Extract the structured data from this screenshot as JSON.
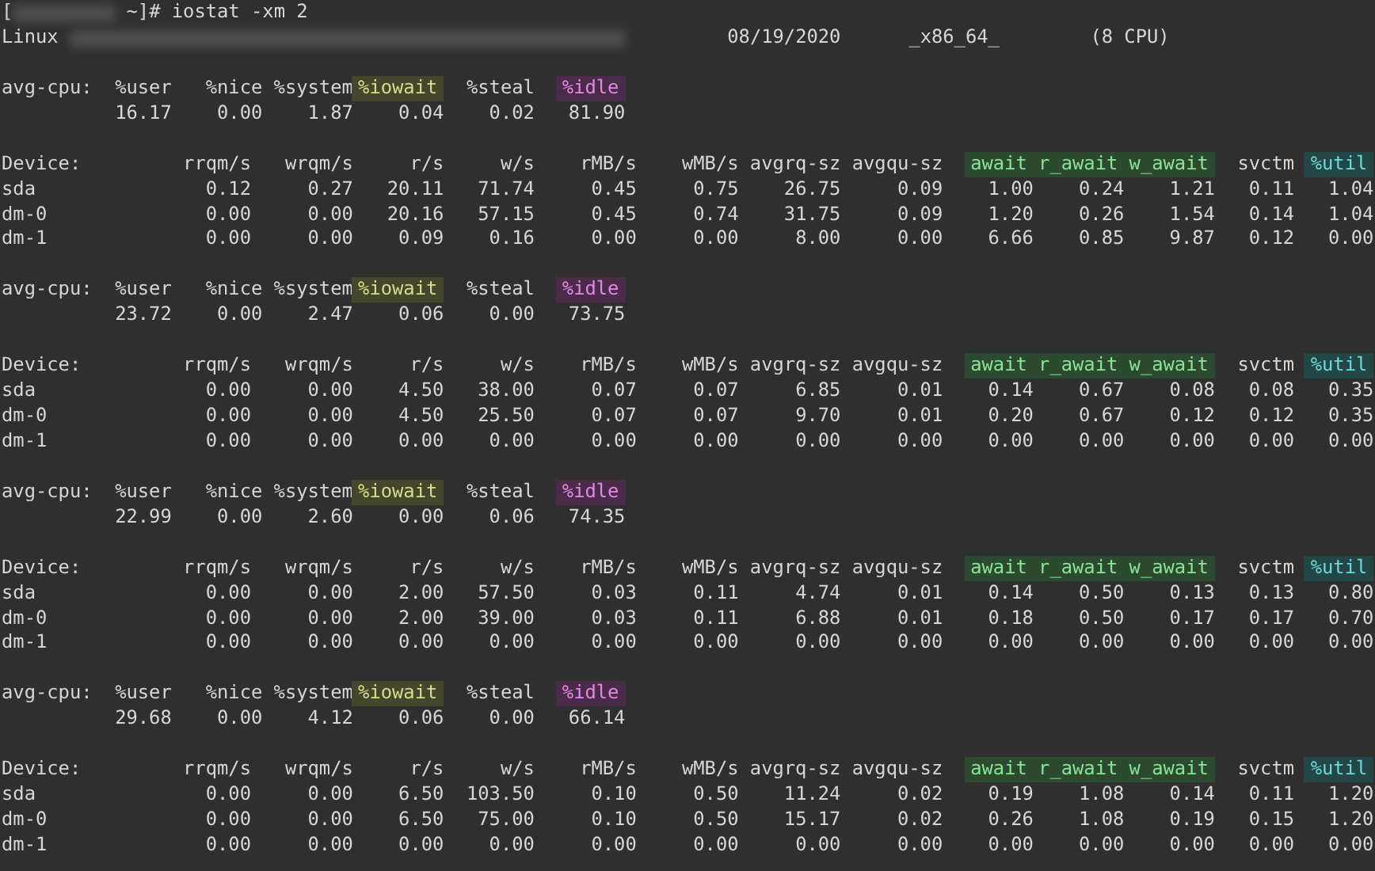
{
  "prompt": {
    "open": "[",
    "command": "~]# iostat -xm 2"
  },
  "system": {
    "os": "Linux",
    "date": "08/19/2020",
    "arch": "_x86_64_",
    "cpus": "(8 CPU)"
  },
  "blocks": [
    {
      "cpu_label": "avg-cpu:",
      "cpu_columns": [
        {
          "label": "%user"
        },
        {
          "label": "%nice"
        },
        {
          "label": "%system"
        },
        {
          "label": "%iowait",
          "color": "#45472d"
        },
        {
          "label": "%steal"
        },
        {
          "label": "%idle",
          "color": "#4a2c4a"
        }
      ],
      "cpu_values": [
        "16.17",
        "0.00",
        "1.87",
        "0.04",
        "0.02",
        "81.90"
      ],
      "device_label": "Device:",
      "device_columns": [
        {
          "label": "rrqm/s"
        },
        {
          "label": "wrqm/s"
        },
        {
          "label": "r/s"
        },
        {
          "label": "w/s"
        },
        {
          "label": "rMB/s"
        },
        {
          "label": "wMB/s"
        },
        {
          "label": "avgrq-sz"
        },
        {
          "label": "avgqu-sz"
        },
        {
          "label": "await",
          "color": "#2c4a30"
        },
        {
          "label": "r_await",
          "color": "#2c4a30"
        },
        {
          "label": "w_await",
          "color": "#2c4a30"
        },
        {
          "label": "svctm"
        },
        {
          "label": "%util",
          "color": "#234646"
        }
      ],
      "rows": [
        {
          "device": "sda",
          "values": [
            "0.12",
            "0.27",
            "20.11",
            "71.74",
            "0.45",
            "0.75",
            "26.75",
            "0.09",
            "1.00",
            "0.24",
            "1.21",
            "0.11",
            "1.04"
          ]
        },
        {
          "device": "dm-0",
          "values": [
            "0.00",
            "0.00",
            "20.16",
            "57.15",
            "0.45",
            "0.74",
            "31.75",
            "0.09",
            "1.20",
            "0.26",
            "1.54",
            "0.14",
            "1.04"
          ]
        },
        {
          "device": "dm-1",
          "values": [
            "0.00",
            "0.00",
            "0.09",
            "0.16",
            "0.00",
            "0.00",
            "8.00",
            "0.00",
            "6.66",
            "0.85",
            "9.87",
            "0.12",
            "0.00"
          ]
        }
      ]
    },
    {
      "cpu_label": "avg-cpu:",
      "cpu_columns": [
        {
          "label": "%user"
        },
        {
          "label": "%nice"
        },
        {
          "label": "%system"
        },
        {
          "label": "%iowait",
          "color": "#45472d"
        },
        {
          "label": "%steal"
        },
        {
          "label": "%idle",
          "color": "#4a2c4a"
        }
      ],
      "cpu_values": [
        "23.72",
        "0.00",
        "2.47",
        "0.06",
        "0.00",
        "73.75"
      ],
      "device_label": "Device:",
      "device_columns": [
        {
          "label": "rrqm/s"
        },
        {
          "label": "wrqm/s"
        },
        {
          "label": "r/s"
        },
        {
          "label": "w/s"
        },
        {
          "label": "rMB/s"
        },
        {
          "label": "wMB/s"
        },
        {
          "label": "avgrq-sz"
        },
        {
          "label": "avgqu-sz"
        },
        {
          "label": "await",
          "color": "#2c4a30"
        },
        {
          "label": "r_await",
          "color": "#2c4a30"
        },
        {
          "label": "w_await",
          "color": "#2c4a30"
        },
        {
          "label": "svctm"
        },
        {
          "label": "%util",
          "color": "#234646"
        }
      ],
      "rows": [
        {
          "device": "sda",
          "values": [
            "0.00",
            "0.00",
            "4.50",
            "38.00",
            "0.07",
            "0.07",
            "6.85",
            "0.01",
            "0.14",
            "0.67",
            "0.08",
            "0.08",
            "0.35"
          ]
        },
        {
          "device": "dm-0",
          "values": [
            "0.00",
            "0.00",
            "4.50",
            "25.50",
            "0.07",
            "0.07",
            "9.70",
            "0.01",
            "0.20",
            "0.67",
            "0.12",
            "0.12",
            "0.35"
          ]
        },
        {
          "device": "dm-1",
          "values": [
            "0.00",
            "0.00",
            "0.00",
            "0.00",
            "0.00",
            "0.00",
            "0.00",
            "0.00",
            "0.00",
            "0.00",
            "0.00",
            "0.00",
            "0.00"
          ]
        }
      ]
    },
    {
      "cpu_label": "avg-cpu:",
      "cpu_columns": [
        {
          "label": "%user"
        },
        {
          "label": "%nice"
        },
        {
          "label": "%system"
        },
        {
          "label": "%iowait",
          "color": "#45472d"
        },
        {
          "label": "%steal"
        },
        {
          "label": "%idle",
          "color": "#4a2c4a"
        }
      ],
      "cpu_values": [
        "22.99",
        "0.00",
        "2.60",
        "0.00",
        "0.06",
        "74.35"
      ],
      "device_label": "Device:",
      "device_columns": [
        {
          "label": "rrqm/s"
        },
        {
          "label": "wrqm/s"
        },
        {
          "label": "r/s"
        },
        {
          "label": "w/s"
        },
        {
          "label": "rMB/s"
        },
        {
          "label": "wMB/s"
        },
        {
          "label": "avgrq-sz"
        },
        {
          "label": "avgqu-sz"
        },
        {
          "label": "await",
          "color": "#2c4a30"
        },
        {
          "label": "r_await",
          "color": "#2c4a30"
        },
        {
          "label": "w_await",
          "color": "#2c4a30"
        },
        {
          "label": "svctm"
        },
        {
          "label": "%util",
          "color": "#234646"
        }
      ],
      "rows": [
        {
          "device": "sda",
          "values": [
            "0.00",
            "0.00",
            "2.00",
            "57.50",
            "0.03",
            "0.11",
            "4.74",
            "0.01",
            "0.14",
            "0.50",
            "0.13",
            "0.13",
            "0.80"
          ]
        },
        {
          "device": "dm-0",
          "values": [
            "0.00",
            "0.00",
            "2.00",
            "39.00",
            "0.03",
            "0.11",
            "6.88",
            "0.01",
            "0.18",
            "0.50",
            "0.17",
            "0.17",
            "0.70"
          ]
        },
        {
          "device": "dm-1",
          "values": [
            "0.00",
            "0.00",
            "0.00",
            "0.00",
            "0.00",
            "0.00",
            "0.00",
            "0.00",
            "0.00",
            "0.00",
            "0.00",
            "0.00",
            "0.00"
          ]
        }
      ]
    },
    {
      "cpu_label": "avg-cpu:",
      "cpu_columns": [
        {
          "label": "%user"
        },
        {
          "label": "%nice"
        },
        {
          "label": "%system"
        },
        {
          "label": "%iowait",
          "color": "#45472d"
        },
        {
          "label": "%steal"
        },
        {
          "label": "%idle",
          "color": "#4a2c4a"
        }
      ],
      "cpu_values": [
        "29.68",
        "0.00",
        "4.12",
        "0.06",
        "0.00",
        "66.14"
      ],
      "device_label": "Device:",
      "device_columns": [
        {
          "label": "rrqm/s"
        },
        {
          "label": "wrqm/s"
        },
        {
          "label": "r/s"
        },
        {
          "label": "w/s"
        },
        {
          "label": "rMB/s"
        },
        {
          "label": "wMB/s"
        },
        {
          "label": "avgrq-sz"
        },
        {
          "label": "avgqu-sz"
        },
        {
          "label": "await",
          "color": "#2c4a30"
        },
        {
          "label": "r_await",
          "color": "#2c4a30"
        },
        {
          "label": "w_await",
          "color": "#2c4a30"
        },
        {
          "label": "svctm"
        },
        {
          "label": "%util",
          "color": "#234646"
        }
      ],
      "rows": [
        {
          "device": "sda",
          "values": [
            "0.00",
            "0.00",
            "6.50",
            "103.50",
            "0.10",
            "0.50",
            "11.24",
            "0.02",
            "0.19",
            "1.08",
            "0.14",
            "0.11",
            "1.20"
          ]
        },
        {
          "device": "dm-0",
          "values": [
            "0.00",
            "0.00",
            "6.50",
            "75.00",
            "0.10",
            "0.50",
            "15.17",
            "0.02",
            "0.26",
            "1.08",
            "0.19",
            "0.15",
            "1.20"
          ]
        },
        {
          "device": "dm-1",
          "values": [
            "0.00",
            "0.00",
            "0.00",
            "0.00",
            "0.00",
            "0.00",
            "0.00",
            "0.00",
            "0.00",
            "0.00",
            "0.00",
            "0.00",
            "0.00"
          ]
        }
      ]
    }
  ]
}
